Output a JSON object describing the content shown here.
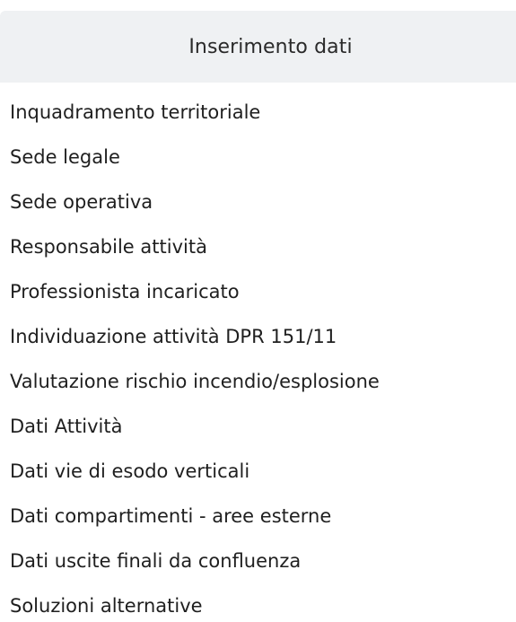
{
  "panel": {
    "title": "Inserimento dati",
    "items": [
      {
        "label": "Inquadramento territoriale"
      },
      {
        "label": "Sede legale"
      },
      {
        "label": "Sede operativa"
      },
      {
        "label": "Responsabile attività"
      },
      {
        "label": "Professionista incaricato"
      },
      {
        "label": "Individuazione attività DPR 151/11"
      },
      {
        "label": "Valutazione rischio incendio/esplosione"
      },
      {
        "label": "Dati Attività"
      },
      {
        "label": "Dati vie di esodo verticali"
      },
      {
        "label": "Dati compartimenti - aree esterne"
      },
      {
        "label": "Dati uscite finali da confluenza"
      },
      {
        "label": "Soluzioni alternative"
      }
    ]
  },
  "colors": {
    "header_background": "#eff1f3",
    "text": "#1f1f1f"
  }
}
